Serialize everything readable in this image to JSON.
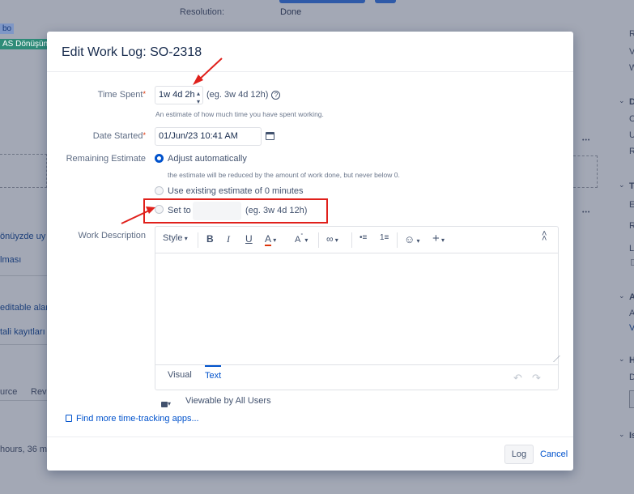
{
  "background": {
    "resolution_label": "Resolution:",
    "resolution_value": "Done",
    "tag_blue": "bo",
    "tag_green": "AS Dönüşün",
    "left_item_1": "önüyzde uy",
    "left_item_2": "lması",
    "left_item_3": "editable alar",
    "left_item_4": "tali kayıtları",
    "left_tab_1": "urce",
    "left_tab_2": "Revi",
    "left_time": "hours, 36 m",
    "right_letters": [
      "R",
      "V",
      "W",
      "D",
      "C",
      "U",
      "R",
      "T",
      "E",
      "R",
      "L",
      "A",
      "A",
      "V",
      "H",
      "D",
      "Is"
    ],
    "ellipsis": "•••"
  },
  "dialog": {
    "title": "Edit Work Log: SO-2318",
    "time_spent": {
      "label": "Time Spent",
      "required_mark": "*",
      "value": "1w 4d 2h",
      "example": "(eg. 3w 4d 12h)",
      "help_icon": "?",
      "hint": "An estimate of how much time you have spent working."
    },
    "date_started": {
      "label": "Date Started",
      "required_mark": "*",
      "value": "01/Jun/23 10:41 AM"
    },
    "remaining_estimate": {
      "label": "Remaining Estimate",
      "option_auto": "Adjust automatically",
      "option_auto_hint": "the estimate will be reduced by the amount of work done, but never below 0.",
      "option_existing": "Use existing estimate of 0 minutes",
      "option_set_to": "Set to",
      "set_to_value": "",
      "set_to_example": "(eg. 3w 4d 12h)",
      "selected": "auto"
    },
    "work_description": {
      "label": "Work Description",
      "toolbar": {
        "style": "Style",
        "bold": "B",
        "italic": "I",
        "underline": "U",
        "text_color": "A",
        "more_format": "A",
        "link": "∞",
        "bullet_list": "•≡",
        "number_list": "1≡",
        "emoji": "☺",
        "insert": "+",
        "collapse": "˄"
      },
      "content": "",
      "tabs": [
        "Visual",
        "Text"
      ],
      "active_tab": "Text",
      "undo": "↶",
      "redo": "↷"
    },
    "visibility": "Viewable by All Users",
    "find_apps_link": "Find more time-tracking apps...",
    "log_button": "Log",
    "cancel_link": "Cancel"
  },
  "colors": {
    "accent": "#0052cc",
    "required": "#de350b",
    "annotation_red": "#e0201b",
    "overlay": "#a3a8b5"
  }
}
